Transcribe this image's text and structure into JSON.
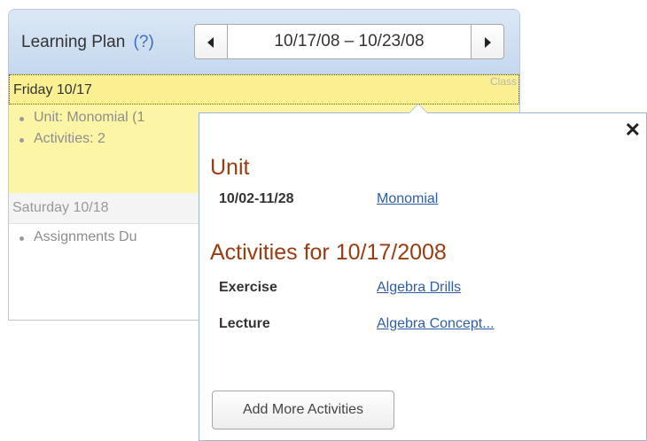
{
  "learning_plan": {
    "title": "Learning Plan",
    "help_label": "(?)",
    "date_range": "10/17/08 – 10/23/08",
    "prev_icon": "arrow-left",
    "next_icon": "arrow-right"
  },
  "days": [
    {
      "label": "Friday 10/17",
      "tab_label": "Class",
      "items": [
        "Unit: Monomial (1",
        "Activities: 2"
      ]
    },
    {
      "label": "Saturday 10/18",
      "items": [
        "Assignments Du"
      ]
    }
  ],
  "popup": {
    "close_label": "✕",
    "unit_title": "Unit",
    "unit": {
      "dates": "10/02-11/28",
      "name": "Monomial"
    },
    "activities_title": "Activities for 10/17/2008",
    "activities": [
      {
        "type": "Exercise",
        "name": "Algebra Drills"
      },
      {
        "type": "Lecture",
        "name": "Algebra Concept..."
      }
    ],
    "add_button": "Add More Activities"
  },
  "colors": {
    "header_bg": "#c5d8ee",
    "friday_bg": "#fdf5a6",
    "section_title": "#9b3c10",
    "link": "#2f5ea8"
  }
}
